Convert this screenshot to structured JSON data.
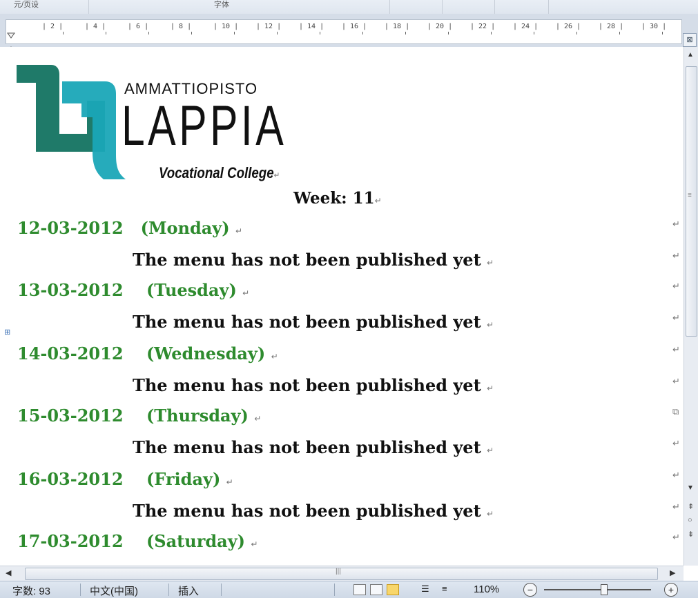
{
  "toolbar_strip": {
    "left_text": "元/页设",
    "mid_text": "字体"
  },
  "ruler": {
    "marks": [
      "2",
      "4",
      "6",
      "8",
      "10",
      "12",
      "14",
      "16",
      "18",
      "20",
      "22",
      "24",
      "26",
      "28",
      "30"
    ]
  },
  "logo": {
    "line1": "AMMATTIOPISTO",
    "line2": "LAPPIA",
    "line3": "Vocational College"
  },
  "paragraph_mark": "↵",
  "week_label": "Week: 11",
  "days": [
    {
      "date": "12-03-2012",
      "weekday": "(Monday)",
      "menu": "The menu has not been published yet"
    },
    {
      "date": "13-03-2012",
      "weekday": "(Tuesday)",
      "menu": "The menu has not been published yet"
    },
    {
      "date": "14-03-2012",
      "weekday": "(Wednesday)",
      "menu": "The menu has not been published yet"
    },
    {
      "date": "15-03-2012",
      "weekday": "(Thursday)",
      "menu": "The menu has not been published yet"
    },
    {
      "date": "16-03-2012",
      "weekday": "(Friday)",
      "menu": "The menu has not been published yet"
    },
    {
      "date": "17-03-2012",
      "weekday": "(Saturday)",
      "menu": ""
    }
  ],
  "colors": {
    "date_green": "#2e8b2e",
    "logo_teal": "#1f7a69",
    "logo_cyan": "#1aa6b7"
  },
  "statusbar": {
    "word_count": "字数: 93",
    "language": "中文(中国)",
    "mode": "插入",
    "zoom": "110%"
  }
}
